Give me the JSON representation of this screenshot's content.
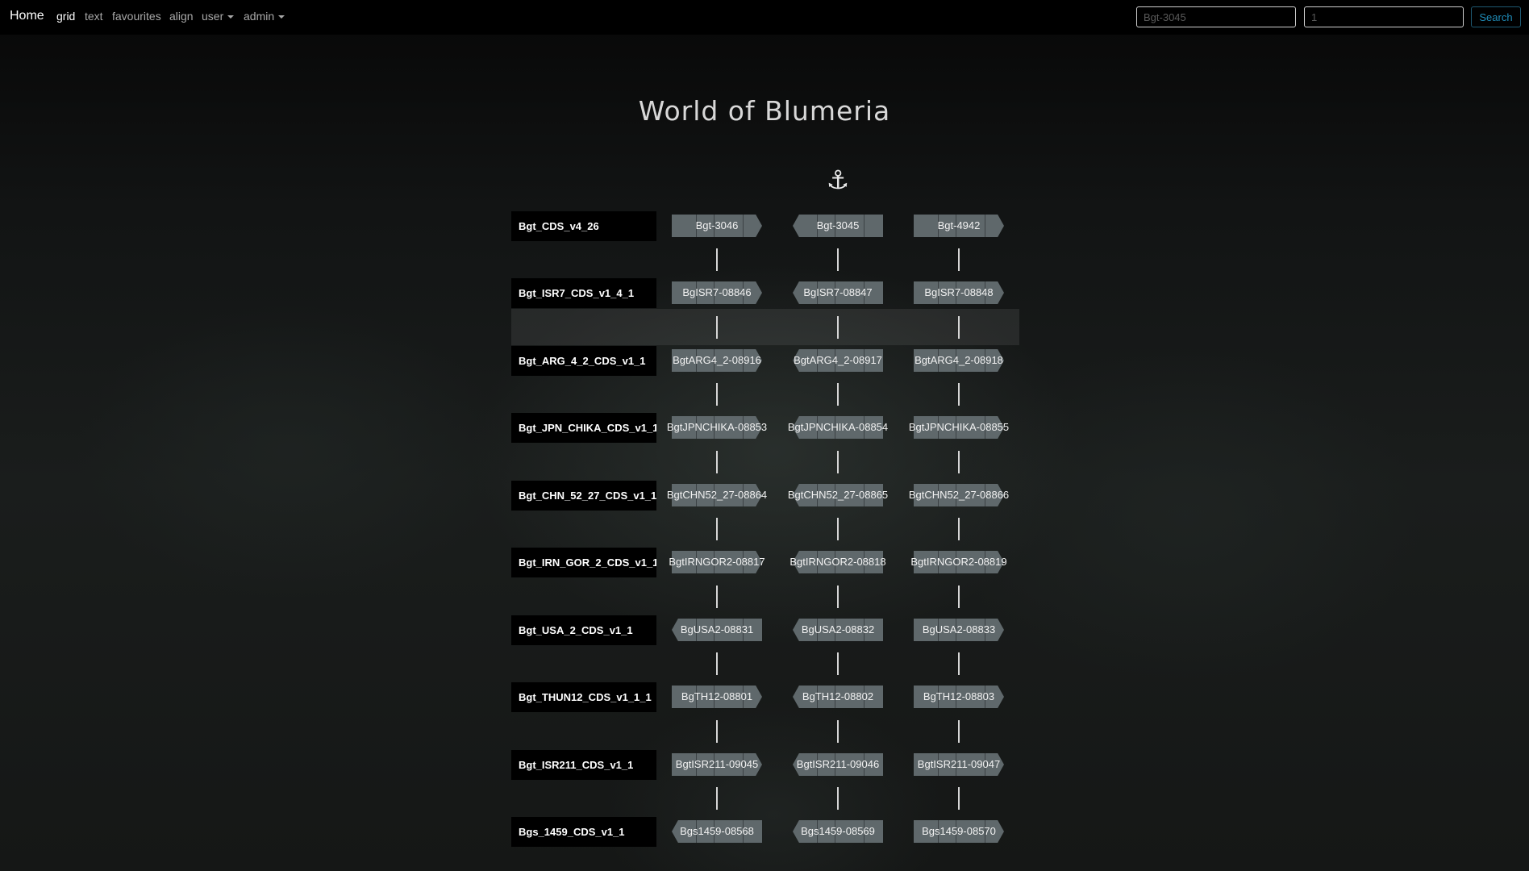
{
  "navbar": {
    "brand": "Home",
    "items": [
      {
        "label": "grid",
        "active": true,
        "dropdown": false
      },
      {
        "label": "text",
        "active": false,
        "dropdown": false
      },
      {
        "label": "favourites",
        "active": false,
        "dropdown": false
      },
      {
        "label": "align",
        "active": false,
        "dropdown": false
      },
      {
        "label": "user",
        "active": false,
        "dropdown": true
      },
      {
        "label": "admin",
        "active": false,
        "dropdown": true
      }
    ],
    "search": {
      "gene_placeholder": "Bgt-3045",
      "count_placeholder": "1",
      "button_label": "Search"
    }
  },
  "page": {
    "title": "World of Blumeria",
    "anchor_icon": "anchor-icon",
    "highlighted_row_gap": 1
  },
  "colors": {
    "gene_fill": "#5f686b",
    "row_label_bg": "#000000",
    "connector": "#d6d6d6",
    "search_accent": "#1f8cb8"
  },
  "grid": {
    "rows": [
      {
        "label": "Bgt_CDS_v4_26",
        "genes": [
          "Bgt-3046",
          "Bgt-3045",
          "Bgt-4942"
        ],
        "dirs": [
          "right",
          "left",
          "right"
        ]
      },
      {
        "label": "Bgt_ISR7_CDS_v1_4_1",
        "genes": [
          "BgISR7-08846",
          "BgISR7-08847",
          "BgISR7-08848"
        ],
        "dirs": [
          "right",
          "left",
          "right"
        ]
      },
      {
        "label": "Bgt_ARG_4_2_CDS_v1_1",
        "genes": [
          "BgtARG4_2-08916",
          "BgtARG4_2-08917",
          "BgtARG4_2-08918"
        ],
        "dirs": [
          "right",
          "left",
          "right"
        ]
      },
      {
        "label": "Bgt_JPN_CHIKA_CDS_v1_1",
        "genes": [
          "BgtJPNCHIKA-08853",
          "BgtJPNCHIKA-08854",
          "BgtJPNCHIKA-08855"
        ],
        "dirs": [
          "right",
          "left",
          "right"
        ]
      },
      {
        "label": "Bgt_CHN_52_27_CDS_v1_1",
        "genes": [
          "BgtCHN52_27-08864",
          "BgtCHN52_27-08865",
          "BgtCHN52_27-08866"
        ],
        "dirs": [
          "right",
          "left",
          "right"
        ]
      },
      {
        "label": "Bgt_IRN_GOR_2_CDS_v1_1",
        "genes": [
          "BgtIRNGOR2-08817",
          "BgtIRNGOR2-08818",
          "BgtIRNGOR2-08819"
        ],
        "dirs": [
          "right",
          "left",
          "right"
        ]
      },
      {
        "label": "Bgt_USA_2_CDS_v1_1",
        "genes": [
          "BgUSA2-08831",
          "BgUSA2-08832",
          "BgUSA2-08833"
        ],
        "dirs": [
          "left",
          "left",
          "right"
        ]
      },
      {
        "label": "Bgt_THUN12_CDS_v1_1_1",
        "genes": [
          "BgTH12-08801",
          "BgTH12-08802",
          "BgTH12-08803"
        ],
        "dirs": [
          "right",
          "left",
          "right"
        ]
      },
      {
        "label": "Bgt_ISR211_CDS_v1_1",
        "genes": [
          "BgtISR211-09045",
          "BgtISR211-09046",
          "BgtISR211-09047"
        ],
        "dirs": [
          "right",
          "left",
          "right"
        ]
      },
      {
        "label": "Bgs_1459_CDS_v1_1",
        "genes": [
          "Bgs1459-08568",
          "Bgs1459-08569",
          "Bgs1459-08570"
        ],
        "dirs": [
          "left",
          "left",
          "right"
        ]
      }
    ]
  }
}
